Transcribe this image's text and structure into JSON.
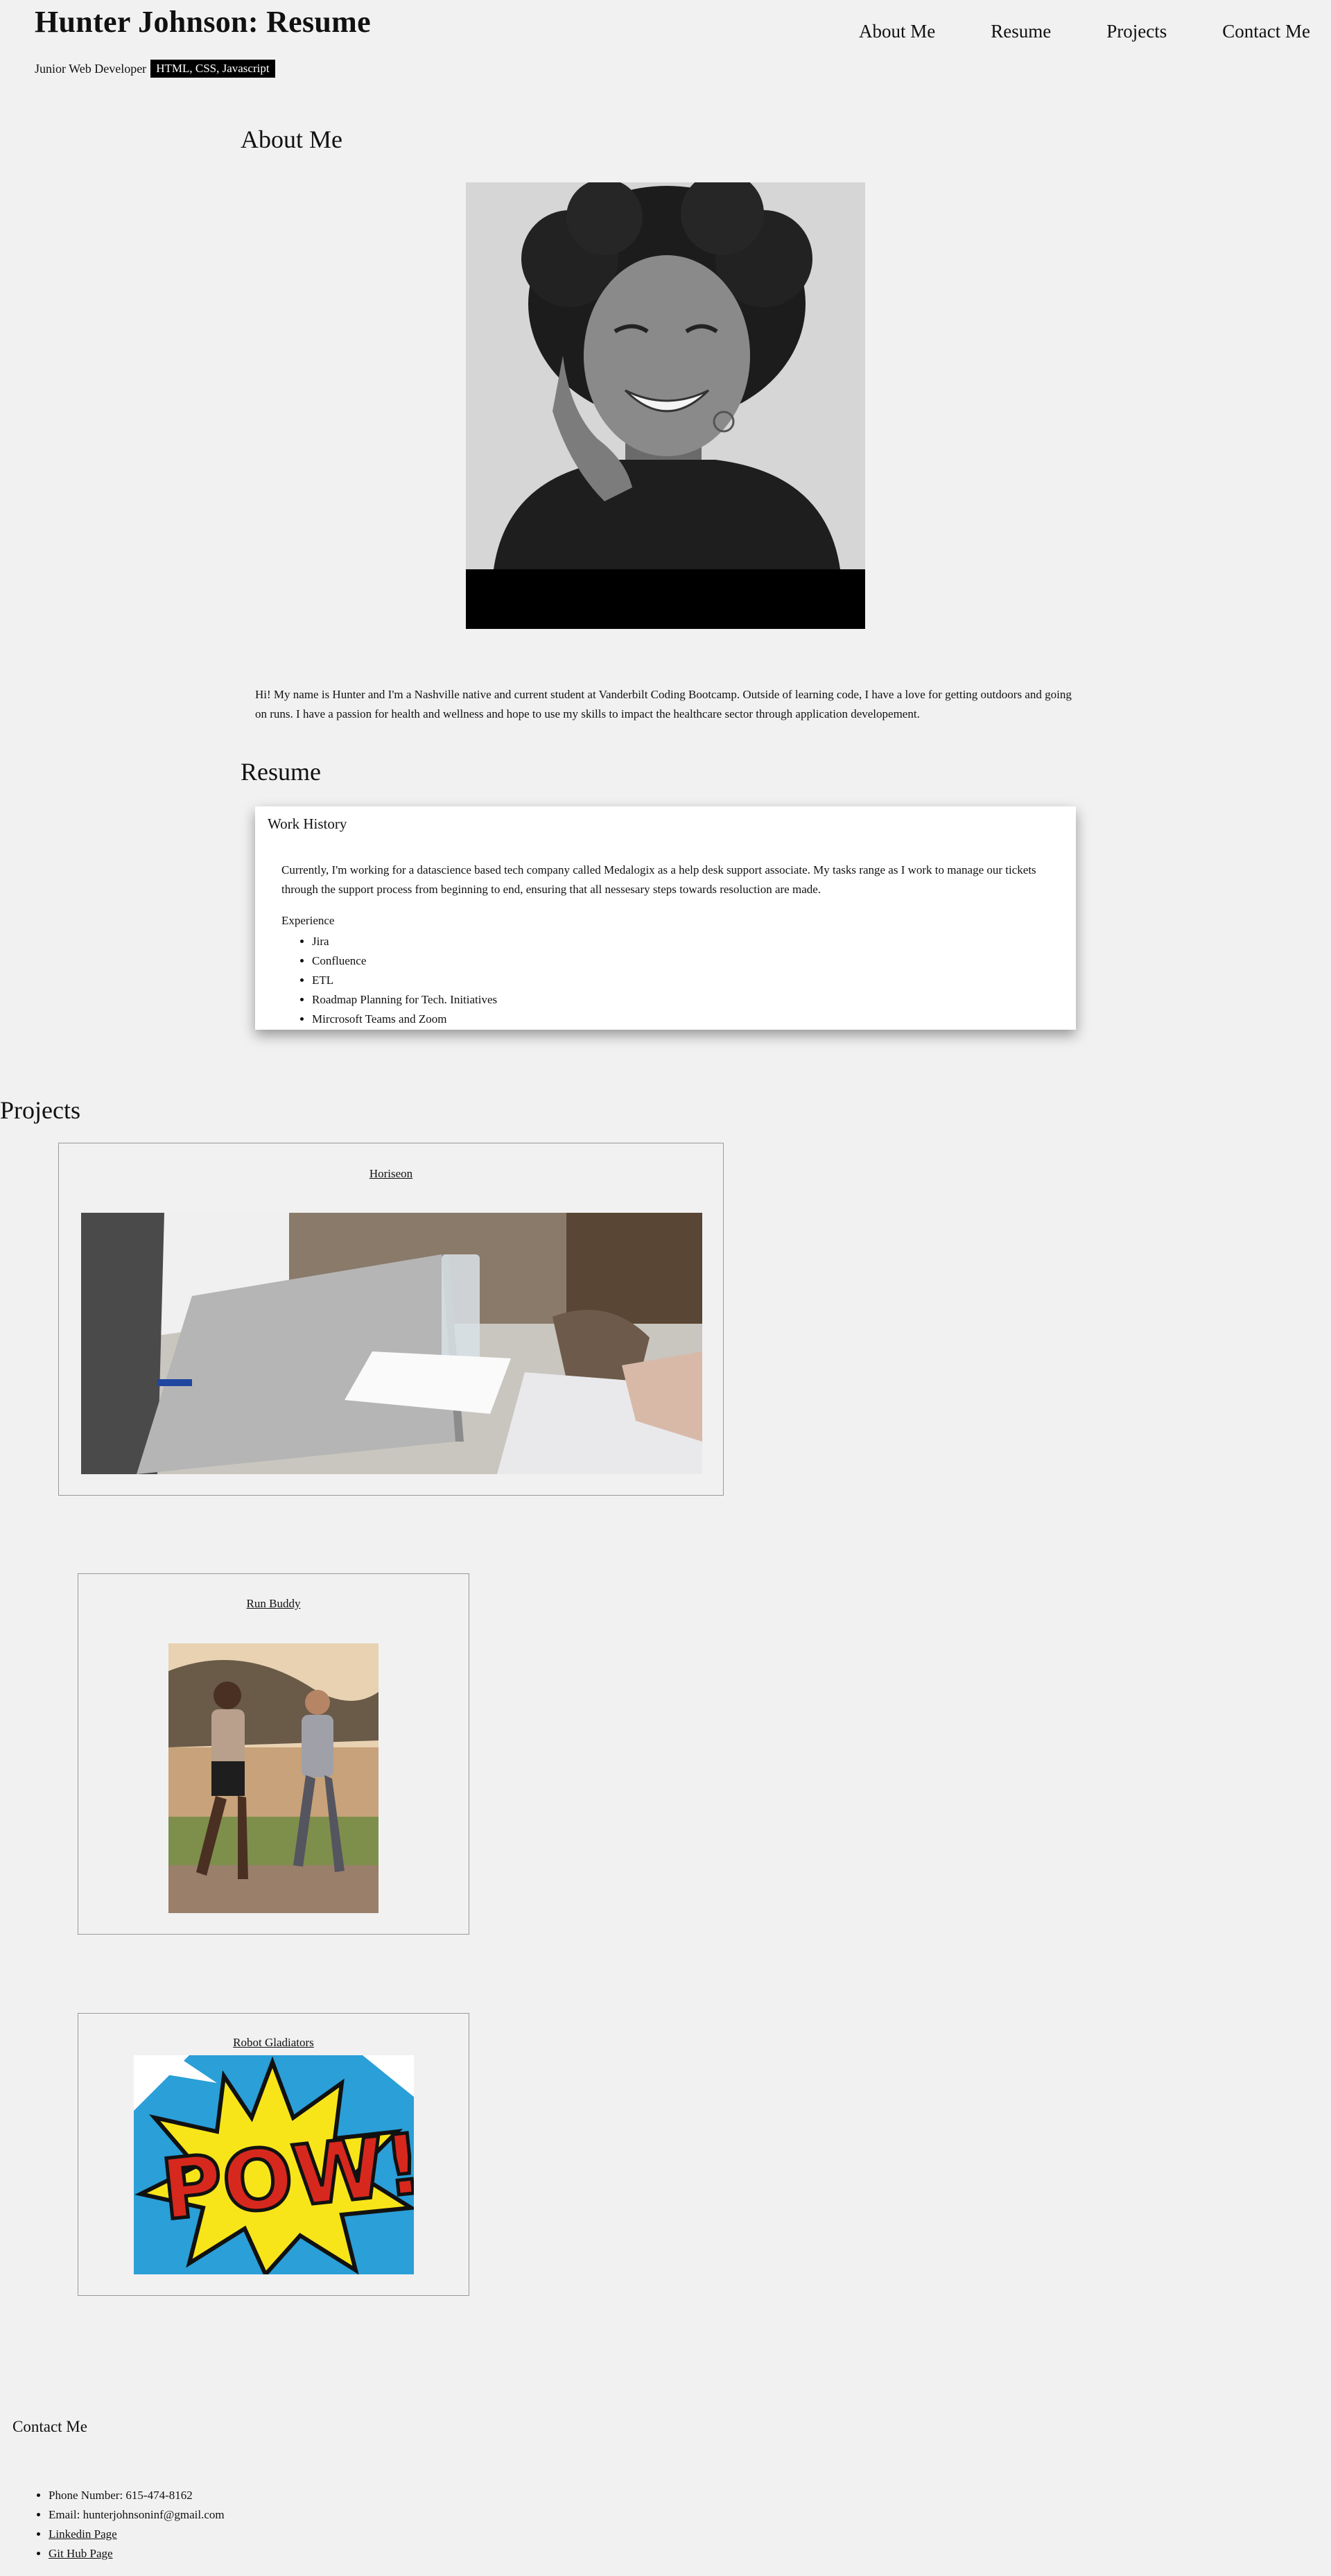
{
  "header": {
    "title": "Hunter Johnson: Resume",
    "subtitle": "Junior Web Developer",
    "skills_badge": "HTML, CSS, Javascript"
  },
  "nav": {
    "items": [
      "About Me",
      "Resume",
      "Projects",
      "Contact Me"
    ]
  },
  "about": {
    "heading": "About Me",
    "bio": "Hi! My name is Hunter and I'm a Nashville native and current student at Vanderbilt Coding Bootcamp. Outside of learning code, I have a love for getting outdoors and going on runs. I have a passion for health and wellness and hope to use my skills to impact the healthcare sector through application developement."
  },
  "resume": {
    "heading": "Resume",
    "card_title": "Work History",
    "text": "Currently, I'm working for a datascience based tech company called Medalogix as a help desk support associate. My tasks range as I work to manage our tickets through the support process from beginning to end, ensuring that all nessesary steps towards resoluction are made.",
    "experience_label": "Experience",
    "experience": [
      "Jira",
      "Confluence",
      "ETL",
      "Roadmap Planning for Tech. Initiatives",
      "Mircrosoft Teams and Zoom"
    ]
  },
  "projects": {
    "heading": "Projects",
    "items": [
      {
        "title": "Horiseon"
      },
      {
        "title": "Run Buddy"
      },
      {
        "title": "Robot Gladiators"
      }
    ]
  },
  "contact": {
    "heading": "Contact Me",
    "phone": "Phone Number: 615-474-8162",
    "email": "Email: hunterjohnsoninf@gmail.com",
    "linkedin": "Linkedin Page",
    "github": "Git Hub Page"
  }
}
